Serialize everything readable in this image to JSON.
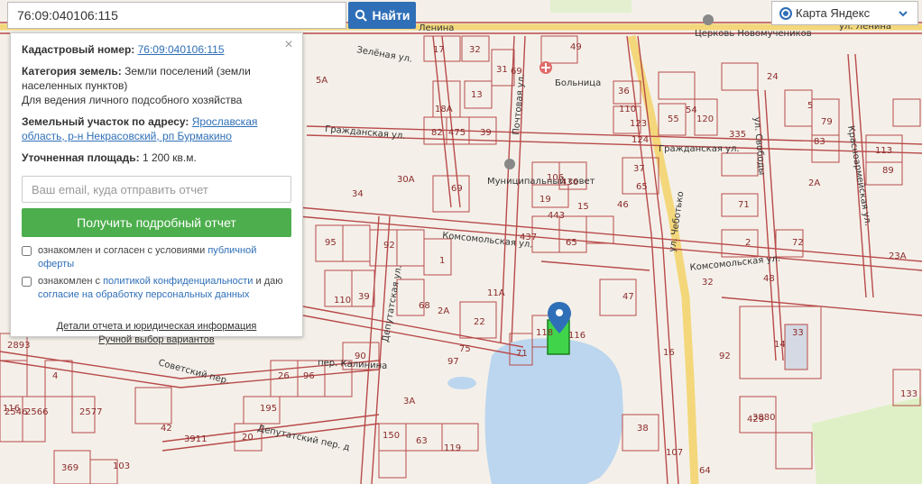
{
  "search": {
    "value": "76:09:040106:115",
    "button_label": "Найти"
  },
  "layer": {
    "label": "Карта Яндекс"
  },
  "panel": {
    "cadastral_label": "Кадастровый номер:",
    "cadastral_value": "76:09:040106:115",
    "category_label": "Категория земель:",
    "category_value": "Земли поселений (земли населенных пунктов)",
    "category_purpose": "Для ведения личного подсобного хозяйства",
    "address_label": "Земельный участок по адресу:",
    "address_value": "Ярославская область, р-н Некрасовский, рп Бурмакино",
    "area_label": "Уточненная площадь:",
    "area_value": "1 200 кв.м.",
    "email_placeholder": "Ваш email, куда отправить отчет",
    "report_button": "Получить подробный отчет",
    "agree1_text": "ознакомлен и согласен с условиями",
    "agree1_link": "публичной оферты",
    "agree2_text": "ознакомлен с",
    "agree2_link": "политикой конфиденциальности",
    "agree2_mid": "и даю",
    "agree2_link2": "согласие на обработку персональных данных",
    "details_link": "Детали отчета и юридическая информация",
    "manual_link": "Ручной выбор вариантов"
  },
  "map": {
    "streets": [
      "Ленина",
      "ул. Ленина",
      "Зелёная ул.",
      "Гражданская ул.",
      "Гражданская ул.",
      "Почтовая ул.",
      "Комсомольская ул.",
      "Комсомольская ул.",
      "ул. Чеботько",
      "ул. Свободы",
      "Красноармейская ул.",
      "Депутатская ул.",
      "пер. Калинина",
      "Советский пер.",
      "Депутатский пер. д"
    ],
    "pois": [
      "Церковь Новомучеников",
      "Больница",
      "Муниципальный совет"
    ],
    "plots": [
      "17",
      "32",
      "31",
      "69",
      "49",
      "5А",
      "18А",
      "13",
      "82",
      "475",
      "39",
      "36",
      "110",
      "123",
      "124",
      "24",
      "55",
      "54",
      "120",
      "5",
      "79",
      "335",
      "83",
      "113",
      "89",
      "34",
      "30А",
      "69",
      "106",
      "436",
      "37",
      "65",
      "2А",
      "46",
      "19",
      "443",
      "15",
      "71",
      "95",
      "92",
      "437",
      "65",
      "2",
      "72",
      "23А",
      "1",
      "11А",
      "47",
      "32",
      "48",
      "110",
      "39",
      "68",
      "2А",
      "22",
      "118",
      "116",
      "14",
      "33",
      "2893",
      "90",
      "3А",
      "26",
      "96",
      "97",
      "75",
      "16",
      "71",
      "92",
      "116",
      "4",
      "2566",
      "2546",
      "2577",
      "195",
      "42",
      "3911",
      "3880",
      "38",
      "107",
      "20",
      "150",
      "63",
      "119",
      "369",
      "103",
      "64",
      "133",
      "429",
      "68"
    ]
  }
}
